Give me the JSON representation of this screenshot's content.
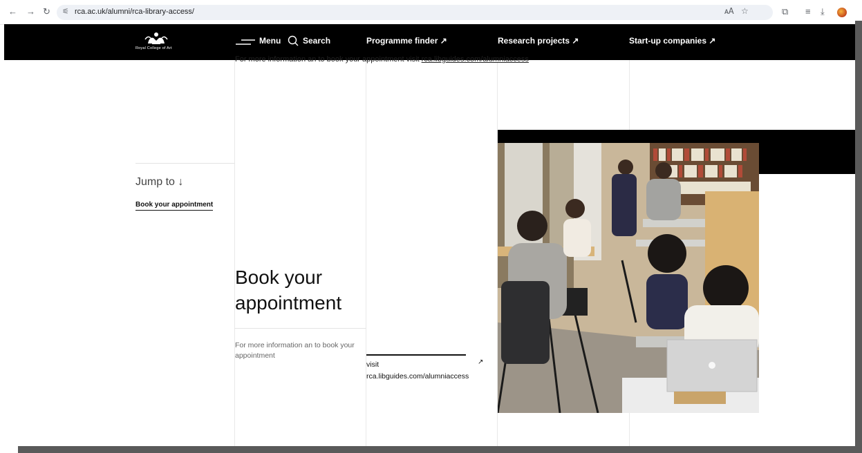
{
  "browser": {
    "url": "rca.ac.uk/alumni/rca-library-access/"
  },
  "header": {
    "logo_text": "Royal College of Art",
    "menu_label": "Menu",
    "search_label": "Search",
    "programme_finder": "Programme finder ↗",
    "research_projects": "Research projects ↗",
    "startup_companies": "Start-up companies ↗"
  },
  "top_text": {
    "prefix": "For more information an to book your appointment visit ",
    "link": "rca.libguides.com/alumniaccess"
  },
  "jump": {
    "label": "Jump to ↓",
    "link": "Book your appointment"
  },
  "section": {
    "heading_line1": "Book your",
    "heading_line2": "appointment",
    "description": "For more information an to book your appointment",
    "visit_line1": "visit",
    "visit_line2": "rca.libguides.com/alumniaccess",
    "arrow": "↗"
  }
}
